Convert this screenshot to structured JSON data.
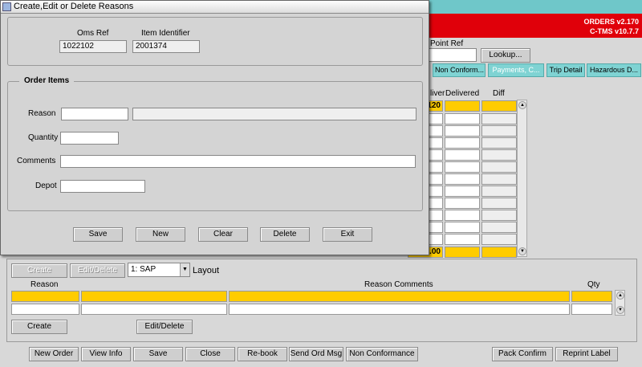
{
  "app": {
    "version_orders": "ORDERS v2.170",
    "version_ctms": "C-TMS v10.7.7",
    "point_ref_label": "Point Ref",
    "point_ref_value": "",
    "lookup_button": "Lookup...",
    "tabs": [
      "Non Conform...",
      "Payments, C...",
      "Trip Detail",
      "Hazardous D..."
    ],
    "grid_headers": [
      "liver",
      "Delivered",
      "Diff"
    ],
    "grid_first_value": "120",
    "grid_total_value": ".00",
    "create_top": "Create",
    "edit_delete_top": "Edit/Delete",
    "layout_select": "1: SAP",
    "layout_label": "Layout",
    "reasons_grid": {
      "headers": [
        "Reason",
        "Reason Comments",
        "Qty"
      ]
    },
    "create_button": "Create",
    "edit_delete_button": "Edit/Delete",
    "bottom_buttons": [
      "New Order",
      "View Info",
      "Save",
      "Close",
      "Re-book",
      "Send Ord Msg",
      "Non Conformance"
    ],
    "right_buttons": [
      "Pack Confirm",
      "Reprint Label"
    ]
  },
  "dialog": {
    "title": "Create,Edit or Delete Reasons",
    "oms_ref_label": "Oms Ref",
    "oms_ref_value": "1022102",
    "item_id_label": "Item Identifier",
    "item_id_value": "2001374",
    "order_items_label": "Order Items",
    "reason_label": "Reason",
    "reason_value": "",
    "reason_desc_value": "",
    "quantity_label": "Quantity",
    "quantity_value": "",
    "comments_label": "Comments",
    "comments_value": "",
    "depot_label": "Depot",
    "depot_value": "",
    "buttons": {
      "save": "Save",
      "new": "New",
      "clear": "Clear",
      "delete": "Delete",
      "exit": "Exit"
    }
  }
}
